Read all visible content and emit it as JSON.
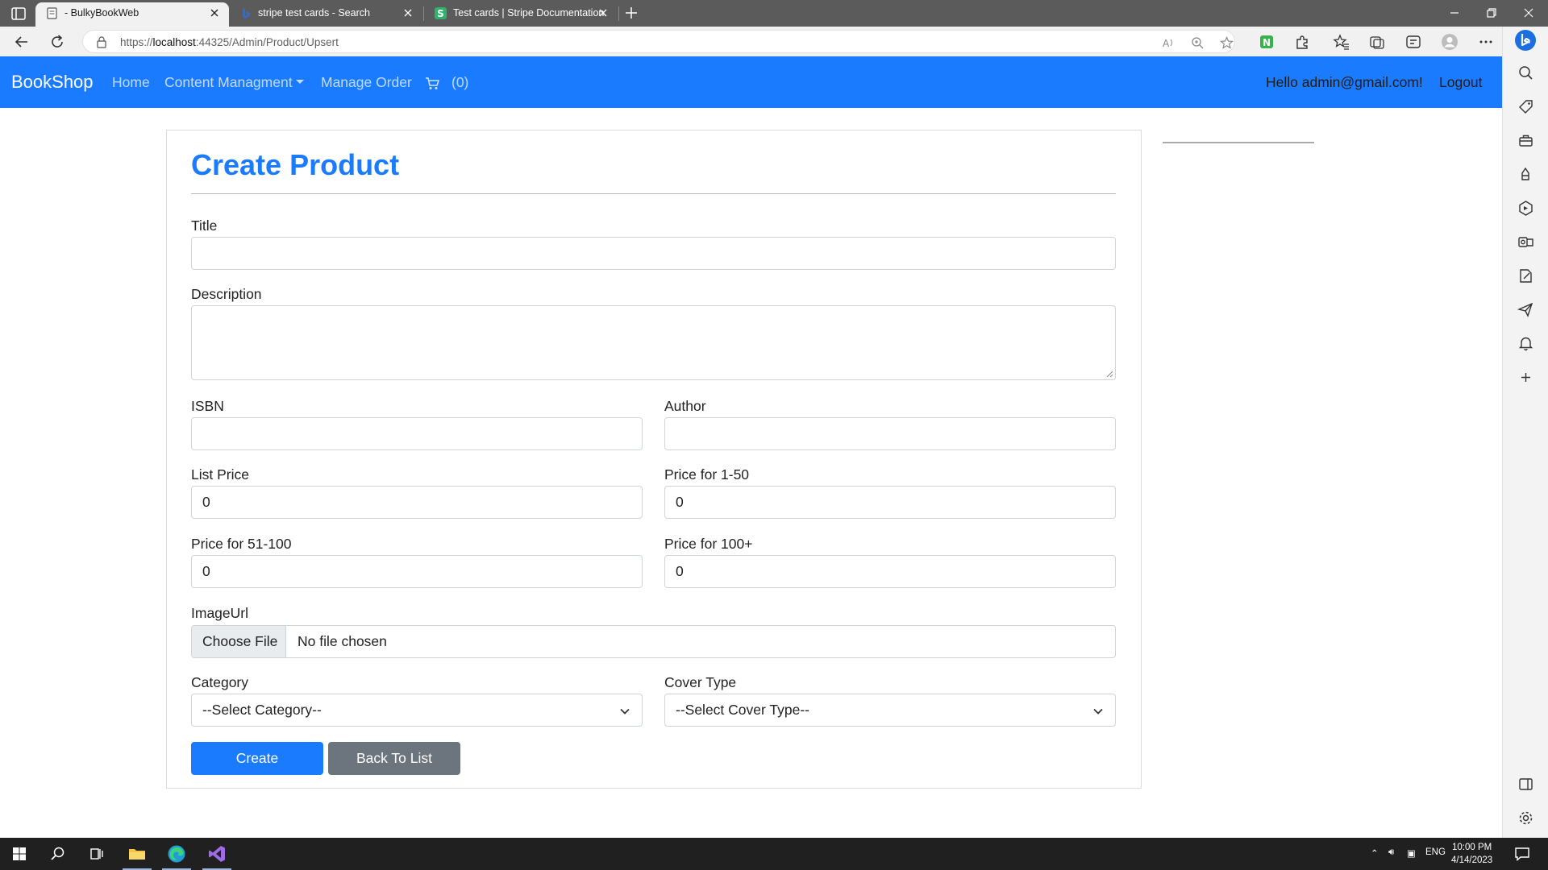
{
  "browser": {
    "tabs": [
      {
        "title": "- BulkyBookWeb",
        "active": true
      },
      {
        "title": "stripe test cards - Search",
        "active": false
      },
      {
        "title": "Test cards | Stripe Documentation",
        "active": false
      }
    ],
    "address": {
      "scheme": "https://",
      "host": "localhost",
      "rest": ":44325/Admin/Product/Upsert"
    }
  },
  "navbar": {
    "brand": "BookShop",
    "links": [
      "Home",
      "Content Managment",
      "Manage Order"
    ],
    "cart_count": "(0)",
    "greeting": "Hello admin@gmail.com!",
    "logout": "Logout"
  },
  "form": {
    "heading": "Create Product",
    "title_label": "Title",
    "title_value": "",
    "description_label": "Description",
    "isbn_label": "ISBN",
    "author_label": "Author",
    "list_price_label": "List Price",
    "list_price_value": "0",
    "price_1_50_label": "Price for 1-50",
    "price_1_50_value": "0",
    "price_51_100_label": "Price for 51-100",
    "price_51_100_value": "0",
    "price_100_label": "Price for 100+",
    "price_100_value": "0",
    "image_label": "ImageUrl",
    "choose_file": "Choose File",
    "file_status": "No file chosen",
    "category_label": "Category",
    "category_selected": "--Select Category--",
    "cover_type_label": "Cover Type",
    "cover_type_selected": "--Select Cover Type--",
    "create_button": "Create",
    "back_button": "Back To List"
  },
  "taskbar": {
    "language": "ENG",
    "time": "10:00 PM",
    "date": "4/14/2023"
  },
  "colors": {
    "primary": "#1a7bff",
    "secondary": "#6c757d",
    "tab_strip": "#5b5b5b",
    "taskbar": "#202020"
  },
  "icons": [
    "tab-actions-icon",
    "tab-favicon-icon",
    "close-icon",
    "new-tab-icon",
    "minimize-icon",
    "restore-icon",
    "close-window-icon",
    "back-arrow-icon",
    "refresh-icon",
    "lock-icon",
    "read-aloud-icon",
    "zoom-icon",
    "favorite-add-icon",
    "extension-icon",
    "puzzle-icon",
    "favorites-icon",
    "collections-icon",
    "shopping-icon",
    "profile-icon",
    "more-icon",
    "bing-icon",
    "cart-icon",
    "chevron-down-icon",
    "windows-start-icon",
    "search-icon",
    "task-view-icon",
    "file-explorer-icon",
    "edge-icon",
    "visual-studio-icon",
    "notification-icon"
  ]
}
